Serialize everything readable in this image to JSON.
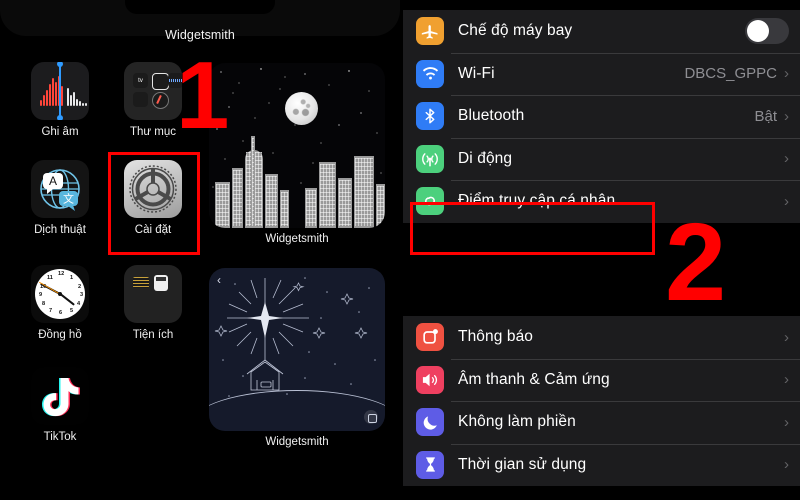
{
  "home_screen": {
    "page_title": "Widgetsmith",
    "apps": [
      {
        "name": "Ghi âm",
        "icon": "voice-memos-icon"
      },
      {
        "name": "Thư mục",
        "icon": "folder-icon"
      },
      {
        "name": "Dịch thuật",
        "icon": "translate-icon"
      },
      {
        "name": "Cài đặt",
        "icon": "settings-gear-icon"
      },
      {
        "name": "Đồng hồ",
        "icon": "clock-icon"
      },
      {
        "name": "Tiện ích",
        "icon": "utilities-folder-icon"
      },
      {
        "name": "TikTok",
        "icon": "tiktok-icon"
      }
    ],
    "widgets": [
      {
        "label": "Widgetsmith",
        "art": "moon-over-city-skyline"
      },
      {
        "label": "Widgetsmith",
        "art": "nativity-star-night-scene"
      }
    ],
    "clock_numerals": [
      "12",
      "1",
      "2",
      "3",
      "4",
      "5",
      "6",
      "7",
      "8",
      "9",
      "10",
      "11"
    ]
  },
  "settings": {
    "group_one": [
      {
        "label": "Chế độ máy bay",
        "icon": "airplane-icon",
        "icon_color": "#f0a030",
        "control": "toggle",
        "toggle_on": false,
        "value": ""
      },
      {
        "label": "Wi-Fi",
        "icon": "wifi-icon",
        "icon_color": "#2f7cf6",
        "control": "chevron",
        "value": "DBCS_GPPC"
      },
      {
        "label": "Bluetooth",
        "icon": "bluetooth-icon",
        "icon_color": "#2f7cf6",
        "control": "chevron",
        "value": "Bật"
      },
      {
        "label": "Di động",
        "icon": "cellular-antenna-icon",
        "icon_color": "#4cd07d",
        "control": "chevron",
        "value": ""
      },
      {
        "label": "Điểm truy cập cá nhân",
        "icon": "personal-hotspot-icon",
        "icon_color": "#4cd07d",
        "control": "chevron",
        "value": ""
      }
    ],
    "group_two": [
      {
        "label": "Thông báo",
        "icon": "notifications-icon",
        "icon_color": "#ef5141",
        "control": "chevron",
        "value": ""
      },
      {
        "label": "Âm thanh & Cảm ứng",
        "icon": "sounds-haptics-icon",
        "icon_color": "#ef4060",
        "control": "chevron",
        "value": ""
      },
      {
        "label": "Không làm phiền",
        "icon": "do-not-disturb-moon-icon",
        "icon_color": "#5e5ce6",
        "control": "chevron",
        "value": ""
      },
      {
        "label": "Thời gian sử dụng",
        "icon": "screen-time-hourglass-icon",
        "icon_color": "#5e5ce6",
        "control": "chevron",
        "value": ""
      }
    ],
    "chevron_glyph": "›"
  },
  "annotations": {
    "accent_color": "#ff0000",
    "step_one": "1",
    "step_two": "2"
  }
}
